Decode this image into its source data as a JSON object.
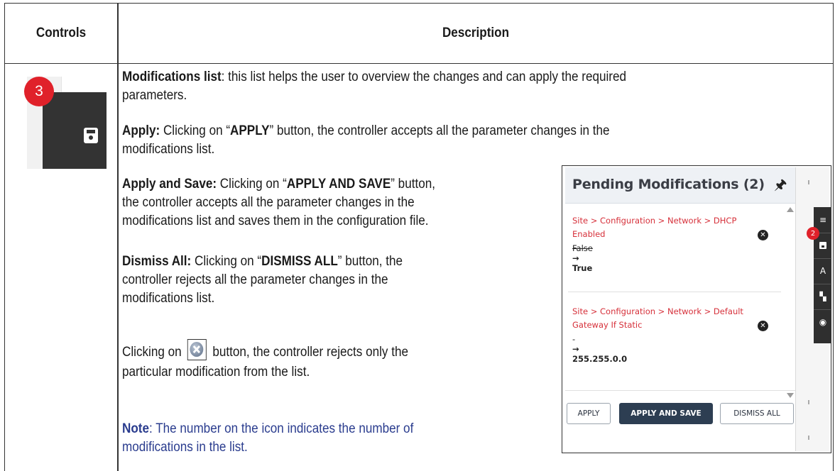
{
  "table": {
    "col_controls": "Controls",
    "col_description": "Description"
  },
  "control": {
    "badge_count": "3",
    "icon": "save-icon"
  },
  "description": {
    "mod_list_title": "Modifications list",
    "mod_list_text1": ": this list helps the user to overview the changes and can apply the required",
    "mod_list_text2": "parameters.",
    "apply_title": "Apply:",
    "apply_text1a": " Clicking on “",
    "apply_btn": "APPLY",
    "apply_text1b": "” button, the controller accepts all the parameter changes in the",
    "apply_text2": "modifications list.",
    "apply_save_title": "Apply and Save:",
    "apply_save_text1a": " Clicking on “",
    "apply_save_btn": "APPLY AND SAVE",
    "apply_save_text1b": "” button,",
    "apply_save_text2": "the controller accepts all the parameter changes in the",
    "apply_save_text3": "modifications list and saves them in the configuration file.",
    "dismiss_title": "Dismiss All:",
    "dismiss_text1a": " Clicking on “",
    "dismiss_btn": "DISMISS ALL",
    "dismiss_text1b": "” button, the",
    "dismiss_text2": "controller rejects all the parameter changes in the",
    "dismiss_text3": "modifications list.",
    "clicking_a": "Clicking on",
    "clicking_b": "button, the controller rejects only the",
    "clicking_text2": "particular modification from the list.",
    "note_title": "Note",
    "note_text1": ": The number on the icon indicates the number of",
    "note_text2": "modifications in the list."
  },
  "panel": {
    "title": "Pending Modifications (2)",
    "modifications": [
      {
        "path_line1": "Site > Configuration > Network > DHCP",
        "path_line2": "Enabled",
        "old_value": "False",
        "arrow": "→",
        "new_value": "True"
      },
      {
        "path_line1": "Site > Configuration > Network > Default",
        "path_line2": "Gateway If Static",
        "old_value": "-",
        "arrow": "→",
        "new_value": "255.255.0.0"
      }
    ],
    "buttons": {
      "apply": "APPLY",
      "apply_and_save": "APPLY AND SAVE",
      "dismiss_all": "DISMISS ALL"
    },
    "side_badge": "2"
  }
}
